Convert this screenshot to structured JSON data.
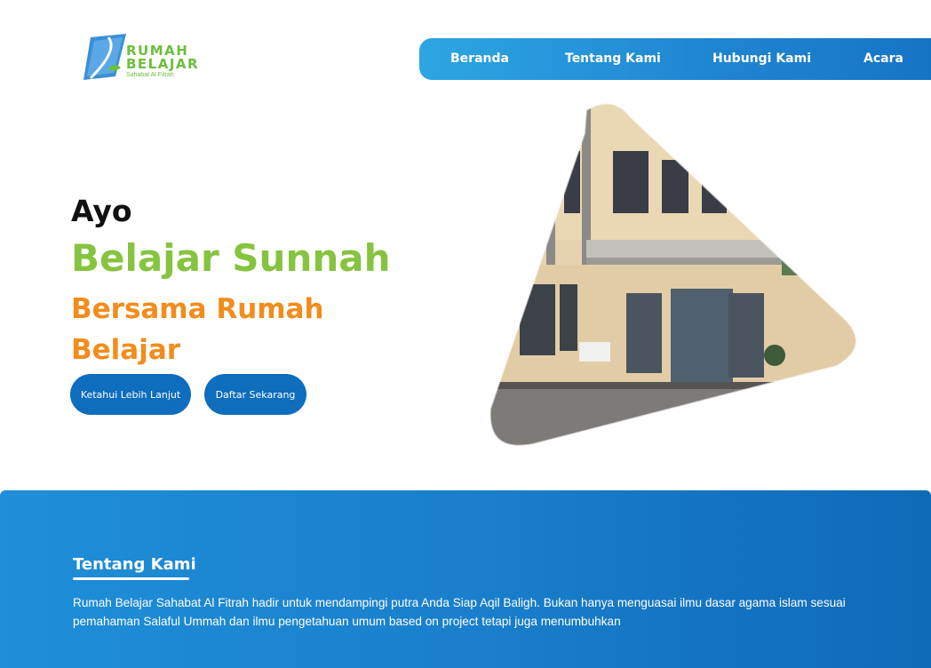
{
  "header": {
    "logo": {
      "word1": "RUMAH",
      "word2": "BELAJAR",
      "sub": "Sahabat Al Fitrah"
    },
    "nav": [
      {
        "label": "Beranda"
      },
      {
        "label": "Tentang Kami"
      },
      {
        "label": "Hubungi Kami"
      },
      {
        "label": "Acara"
      }
    ],
    "nav_gradient": [
      "#2da6e2",
      "#1673c6"
    ]
  },
  "hero": {
    "line1": "Ayo",
    "line2": "Belajar Sunnah",
    "line3_a": "Bersama ",
    "line3_b": "Rumah",
    "line4": "Belajar",
    "buttons": {
      "primary": "Ketahui Lebih Lanjut",
      "secondary": "Daftar Sekarang"
    },
    "colors": {
      "green": "#86c43f",
      "orange": "#f28c1c",
      "button": "#0f6dbd"
    }
  },
  "about": {
    "title": "Tentang Kami",
    "text": "Rumah Belajar Sahabat Al Fitrah hadir untuk mendampingi putra Anda Siap Aqil Baligh. Bukan hanya menguasai ilmu dasar agama islam sesuai pemahaman Salaful Ummah dan ilmu pengetahuan umum based on project tetapi juga menumbuhkan"
  }
}
